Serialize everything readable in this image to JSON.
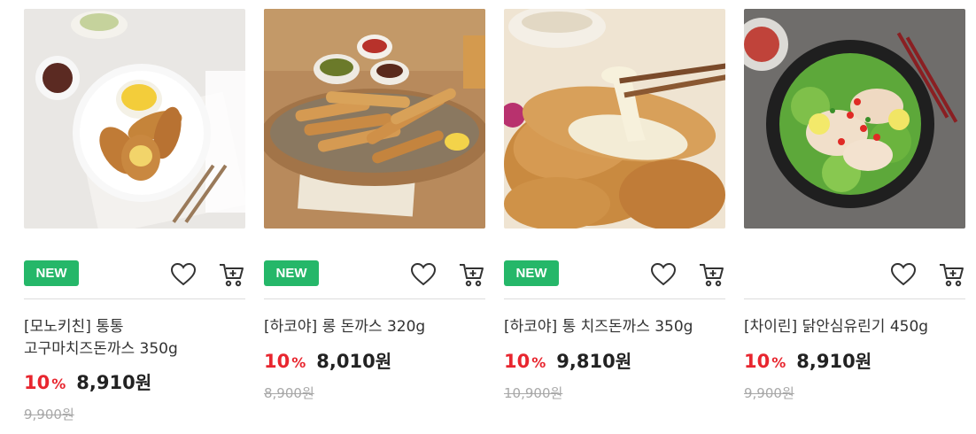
{
  "theme": {
    "badge_color": "#25b769",
    "discount_color": "#e8262f"
  },
  "products": [
    {
      "badge": "NEW",
      "name_line1": "[모노키친] 통통",
      "name_line2": "고구마치즈돈까스 350g",
      "discount": "10",
      "discount_unit": "%",
      "price": "8,910",
      "currency": "원",
      "original_price": "9,900원",
      "wish_icon": "heart-icon",
      "cart_icon": "cart-icon"
    },
    {
      "badge": "NEW",
      "name_line1": "[하코야] 롱 돈까스 320g",
      "name_line2": "",
      "discount": "10",
      "discount_unit": "%",
      "price": "8,010",
      "currency": "원",
      "original_price": "8,900원",
      "wish_icon": "heart-icon",
      "cart_icon": "cart-icon"
    },
    {
      "badge": "NEW",
      "name_line1": "[하코야] 통 치즈돈까스 350g",
      "name_line2": "",
      "discount": "10",
      "discount_unit": "%",
      "price": "9,810",
      "currency": "원",
      "original_price": "10,900원",
      "wish_icon": "heart-icon",
      "cart_icon": "cart-icon"
    },
    {
      "badge": "",
      "name_line1": "[차이린] 닭안심유린기 450g",
      "name_line2": "",
      "discount": "10",
      "discount_unit": "%",
      "price": "8,910",
      "currency": "원",
      "original_price": "9,900원",
      "wish_icon": "heart-icon",
      "cart_icon": "cart-icon"
    }
  ]
}
